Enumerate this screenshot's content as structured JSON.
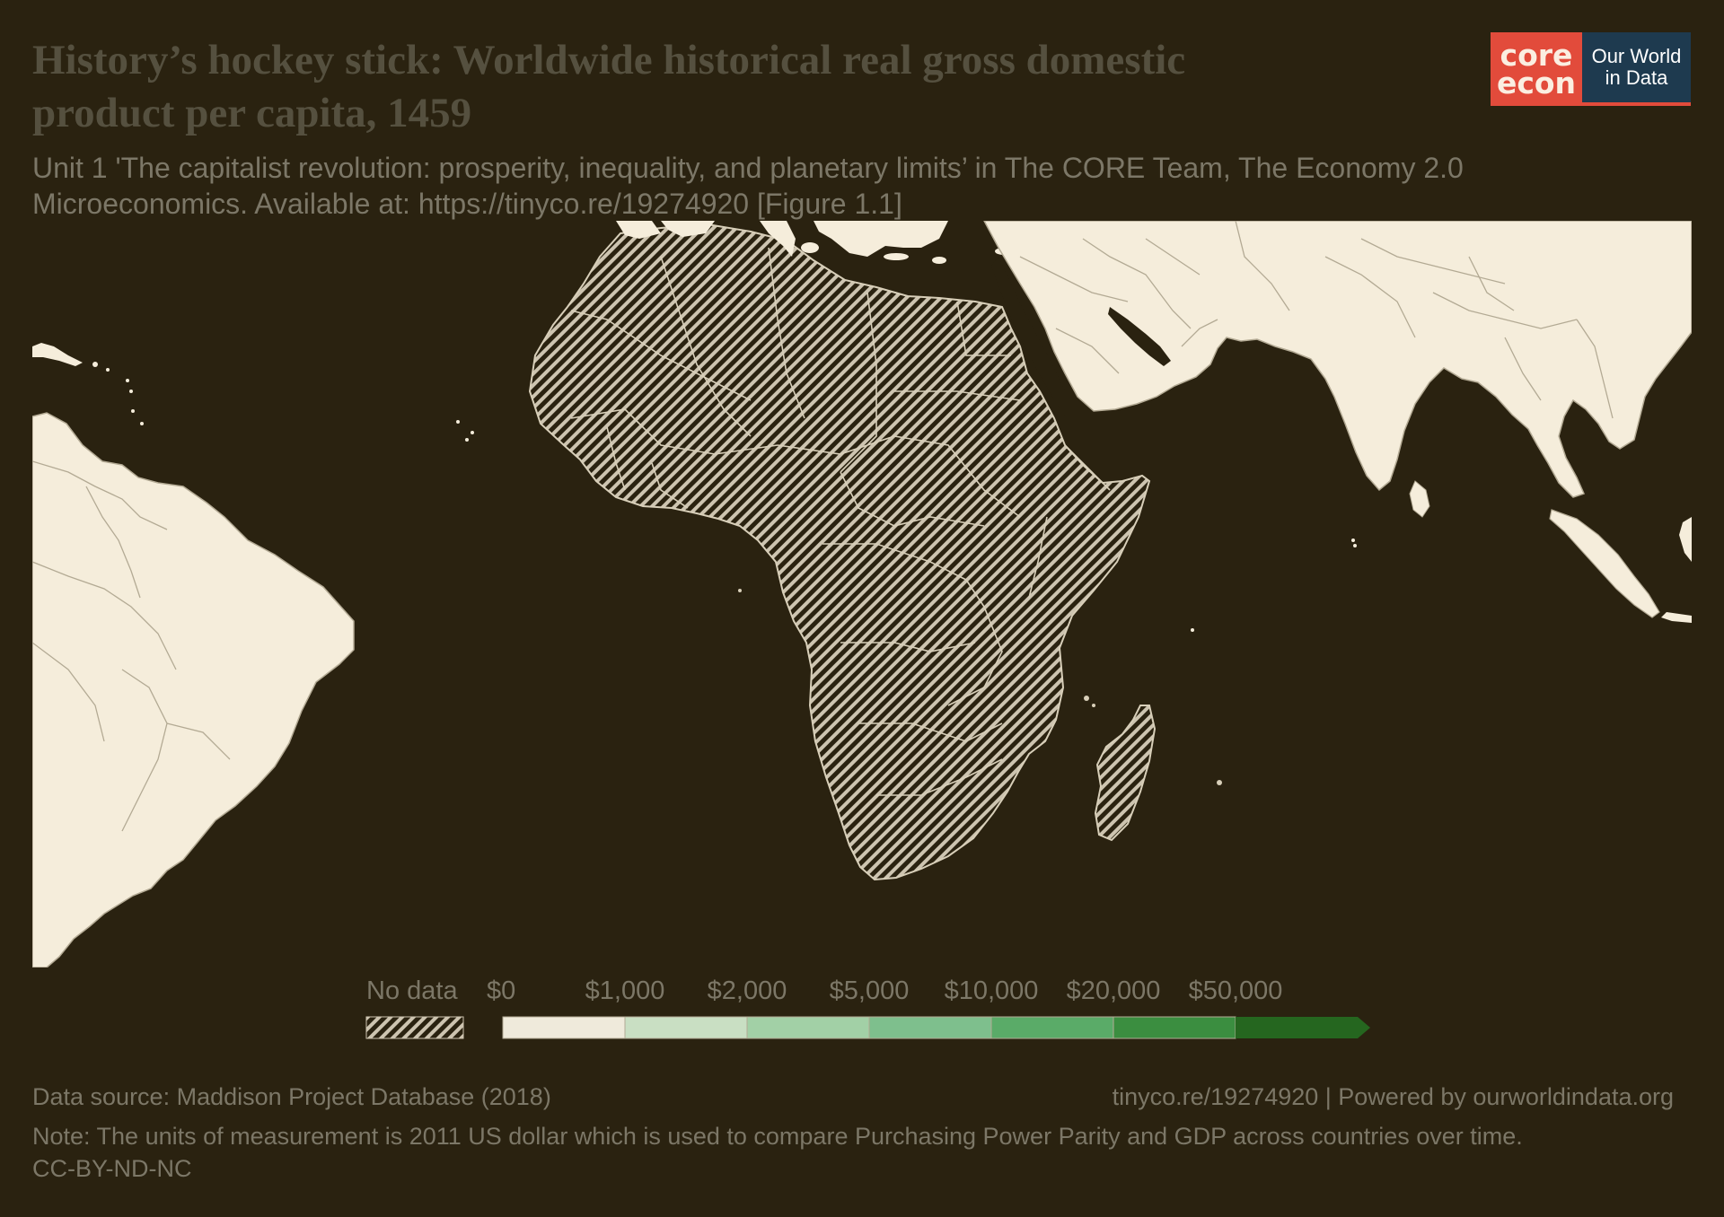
{
  "header": {
    "title": "History’s hockey stick: Worldwide historical real gross domestic product per capita, 1459",
    "subtitle_line1": "Unit 1 'The capitalist revolution: prosperity, inequality, and planetary limits’ in The CORE Team, The Economy 2.0",
    "subtitle_line2": "Microeconomics. Available at: https://tinyco.re/19274920 [Figure 1.1]"
  },
  "logo": {
    "core_line1": "core",
    "core_line2": "econ",
    "owid_line1": "Our World",
    "owid_line2": "in Data"
  },
  "map": {
    "year": 1459,
    "data_status": "No data",
    "region_shown": "Africa, Middle East, South Asia, South America",
    "colors": {
      "background": "#2a2210",
      "land": "#f5eddb",
      "no_data_hatch": "#cdc4b0",
      "border": "#b3aa94"
    }
  },
  "legend": {
    "no_data_label": "No data",
    "bins": [
      "$0",
      "$1,000",
      "$2,000",
      "$5,000",
      "$10,000",
      "$20,000",
      "$50,000"
    ],
    "colors": [
      "#efeadb",
      "#c9dfc3",
      "#a2d0a6",
      "#7ebf8d",
      "#5aab68",
      "#3b8e40",
      "#25661f"
    ]
  },
  "footer": {
    "source": "Data source: Maddison Project Database (2018)",
    "link": "tinyco.re/19274920 | Powered by ourworldindata.org",
    "note": "Note: The units of measurement is 2011 US dollar which is used to compare Purchasing Power Parity and GDP across countries over time.",
    "license": "CC-BY-ND-NC"
  }
}
